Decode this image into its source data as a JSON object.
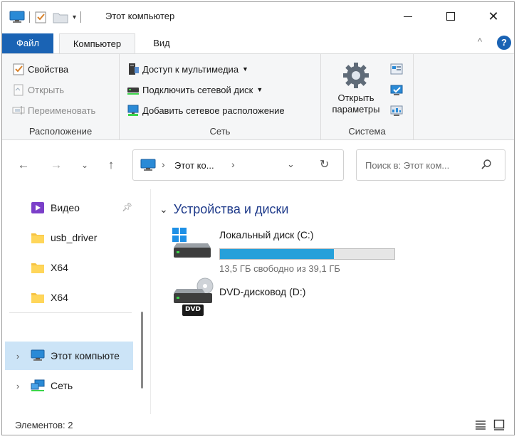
{
  "window": {
    "title": "Этот компьютер"
  },
  "ribbon_tabs": {
    "file": "Файл",
    "computer": "Компьютер",
    "view": "Вид"
  },
  "ribbon": {
    "location": {
      "label": "Расположение",
      "properties": "Свойства",
      "open": "Открыть",
      "rename": "Переименовать"
    },
    "network": {
      "label": "Сеть",
      "media": "Доступ к мультимедиа",
      "map_drive": "Подключить сетевой диск",
      "add_location": "Добавить сетевое расположение"
    },
    "system": {
      "label": "Система",
      "open_settings_line1": "Открыть",
      "open_settings_line2": "параметры"
    }
  },
  "address": {
    "path_root": "Этот ко...",
    "search_placeholder": "Поиск в: Этот ком..."
  },
  "nav_pane": {
    "items": [
      {
        "label": "Видео"
      },
      {
        "label": "usb_driver"
      },
      {
        "label": "X64"
      },
      {
        "label": "X64"
      },
      {
        "label": "Этот компьюте"
      },
      {
        "label": "Сеть"
      }
    ]
  },
  "content": {
    "group_title": "Устройства и диски",
    "drives": [
      {
        "name": "Локальный диск (C:)",
        "free_text": "13,5 ГБ свободно из 39,1 ГБ",
        "used_fraction": 0.655
      },
      {
        "name": "DVD-дисковод (D:)",
        "badge": "DVD"
      }
    ]
  },
  "status": {
    "items_count": "Элементов: 2"
  },
  "colors": {
    "accent": "#1a63b4",
    "progress": "#26a0da",
    "selected": "#cce4f7",
    "group_title": "#1e3a8a"
  }
}
